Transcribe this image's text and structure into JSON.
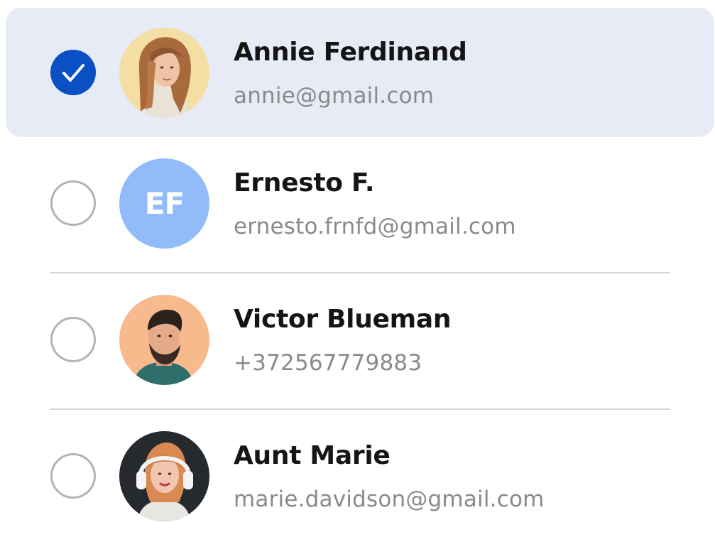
{
  "contacts": [
    {
      "name": "Annie Ferdinand",
      "detail": "annie@gmail.com",
      "selected": true,
      "avatar": "photo-woman-blonde-icon"
    },
    {
      "name": "Ernesto F.",
      "detail": "ernesto.frnfd@gmail.com",
      "selected": false,
      "initials": "EF"
    },
    {
      "name": "Victor Blueman",
      "detail": "+372567779883",
      "selected": false,
      "avatar": "photo-man-beard-icon"
    },
    {
      "name": "Aunt Marie",
      "detail": "marie.davidson@gmail.com",
      "selected": false,
      "avatar": "photo-woman-headphones-icon"
    }
  ],
  "colors": {
    "selected_row_bg": "#e6ebf6",
    "radio_checked": "#0a4fc4",
    "initials_avatar_bg": "#92bcf9"
  }
}
